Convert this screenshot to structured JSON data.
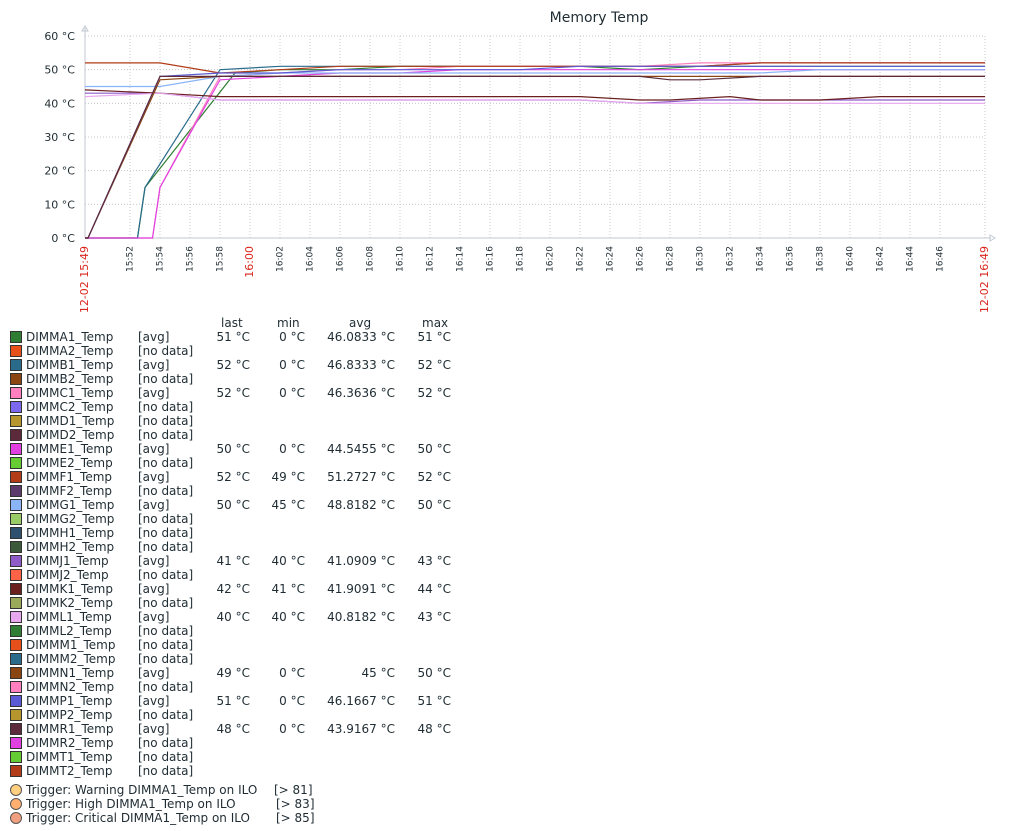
{
  "chart_data": {
    "type": "line",
    "title": "Memory Temp",
    "ylim": [
      0,
      60
    ],
    "y_ticks": [
      "0 °C",
      "10 °C",
      "20 °C",
      "30 °C",
      "40 °C",
      "50 °C",
      "60 °C"
    ],
    "x_start_label": "12-02 15:49",
    "x_end_label": "12-02 16:49",
    "x_mid_highlight_label": "16:00",
    "x_tick_labels": [
      "15:52",
      "15:54",
      "15:56",
      "15:58",
      "16:00",
      "16:02",
      "16:04",
      "16:06",
      "16:08",
      "16:10",
      "16:12",
      "16:14",
      "16:16",
      "16:18",
      "16:20",
      "16:22",
      "16:24",
      "16:26",
      "16:28",
      "16:30",
      "16:32",
      "16:34",
      "16:36",
      "16:38",
      "16:40",
      "16:42",
      "16:44",
      "16:46"
    ],
    "grid": true,
    "series": [
      {
        "name": "DIMMA1_Temp",
        "color": "#2e7d32",
        "x": [
          0,
          3.5,
          4,
          10,
          13,
          17,
          21,
          25,
          29,
          33,
          37,
          41,
          45,
          49,
          53,
          57,
          60
        ],
        "y": [
          0,
          0,
          15,
          49,
          50,
          50,
          51,
          51,
          51,
          51,
          50,
          51,
          51,
          51,
          51,
          51,
          51
        ]
      },
      {
        "name": "DIMMB1_Temp",
        "color": "#2a6b8c",
        "x": [
          0,
          3.5,
          4,
          9,
          13,
          17,
          21,
          25,
          29,
          33,
          37,
          41,
          45,
          49,
          53,
          57,
          60
        ],
        "y": [
          0,
          0,
          15,
          50,
          51,
          51,
          51,
          51,
          51,
          51,
          51,
          51,
          52,
          52,
          52,
          52,
          52
        ]
      },
      {
        "name": "DIMMC1_Temp",
        "color": "#ff7fbf",
        "x": [
          0,
          4.5,
          5,
          9,
          13,
          17,
          21,
          25,
          29,
          33,
          37,
          41,
          45,
          49,
          53,
          57,
          60
        ],
        "y": [
          0,
          0,
          15,
          48,
          49,
          50,
          50,
          51,
          51,
          51,
          51,
          52,
          52,
          52,
          52,
          52,
          52
        ]
      },
      {
        "name": "DIMME1_Temp",
        "color": "#e040e0",
        "x": [
          0,
          4.5,
          5,
          9,
          13,
          17,
          21,
          25,
          29,
          33,
          37,
          41,
          45,
          49,
          53,
          57,
          60
        ],
        "y": [
          0,
          0,
          15,
          47,
          48,
          49,
          49,
          50,
          50,
          50,
          50,
          50,
          50,
          50,
          50,
          50,
          50
        ]
      },
      {
        "name": "DIMMF1_Temp",
        "color": "#b23c17",
        "x": [
          0,
          5,
          9,
          13,
          17,
          21,
          25,
          29,
          33,
          37,
          41,
          45,
          49,
          53,
          57,
          60
        ],
        "y": [
          52,
          52,
          49,
          50,
          51,
          51,
          51,
          51,
          51,
          51,
          51,
          52,
          52,
          52,
          52,
          52
        ]
      },
      {
        "name": "DIMMG1_Temp",
        "color": "#8ab4f8",
        "x": [
          0,
          5,
          9,
          13,
          17,
          21,
          25,
          29,
          33,
          37,
          41,
          45,
          49,
          53,
          57,
          60
        ],
        "y": [
          45,
          45,
          48,
          49,
          49,
          49,
          49,
          49,
          49,
          49,
          49,
          49,
          50,
          50,
          50,
          50
        ]
      },
      {
        "name": "DIMMJ1_Temp",
        "color": "#8e5bc9",
        "x": [
          0,
          5,
          9,
          13,
          17,
          21,
          25,
          29,
          33,
          37,
          41,
          45,
          49,
          53,
          57,
          60
        ],
        "y": [
          43,
          43,
          41,
          41,
          41,
          41,
          41,
          41,
          41,
          40,
          41,
          41,
          41,
          41,
          41,
          41
        ]
      },
      {
        "name": "DIMMK1_Temp",
        "color": "#6b1f1f",
        "x": [
          0,
          5,
          9,
          13,
          17,
          21,
          25,
          29,
          33,
          37,
          39,
          43,
          45,
          49,
          53,
          57,
          60
        ],
        "y": [
          44,
          43,
          42,
          42,
          42,
          42,
          42,
          42,
          42,
          41,
          41,
          42,
          41,
          41,
          42,
          42,
          42
        ]
      },
      {
        "name": "DIMML1_Temp",
        "color": "#e8a8f0",
        "x": [
          0,
          5,
          9,
          13,
          17,
          21,
          25,
          29,
          33,
          37,
          41,
          45,
          49,
          53,
          57,
          60
        ],
        "y": [
          42,
          43,
          41,
          41,
          41,
          41,
          41,
          41,
          41,
          40,
          40,
          40,
          40,
          40,
          40,
          40
        ]
      },
      {
        "name": "DIMMN1_Temp",
        "color": "#8b4513",
        "x": [
          0,
          0.2,
          5,
          9,
          13,
          17,
          21,
          25,
          29,
          33,
          37,
          41,
          45,
          49,
          53,
          57,
          60
        ],
        "y": [
          0,
          0,
          47,
          48,
          48,
          48,
          48,
          48,
          48,
          48,
          48,
          48,
          48,
          48,
          48,
          48,
          48
        ]
      },
      {
        "name": "DIMMP1_Temp",
        "color": "#5a5ad6",
        "x": [
          0,
          0.2,
          5,
          9,
          13,
          17,
          21,
          25,
          29,
          33,
          37,
          41,
          45,
          49,
          53,
          57,
          60
        ],
        "y": [
          0,
          0,
          48,
          49,
          49,
          50,
          50,
          50,
          50,
          51,
          51,
          51,
          51,
          51,
          51,
          51,
          51
        ]
      },
      {
        "name": "DIMMR1_Temp",
        "color": "#5c2a3a",
        "x": [
          0,
          0.2,
          5,
          9,
          13,
          17,
          21,
          25,
          29,
          33,
          37,
          39,
          41,
          45,
          49,
          53,
          60
        ],
        "y": [
          0,
          0,
          48,
          48,
          48,
          48,
          48,
          48,
          48,
          48,
          48,
          47,
          47,
          48,
          48,
          48,
          48
        ]
      }
    ]
  },
  "legend": {
    "headers": {
      "last": "last",
      "min": "min",
      "avg": "avg",
      "max": "max"
    },
    "items": [
      {
        "name": "DIMMA1_Temp",
        "color": "#2e7d32",
        "func": "[avg]",
        "last": "51 °C",
        "min": "0 °C",
        "avg": "46.0833 °C",
        "max": "51 °C"
      },
      {
        "name": "DIMMA2_Temp",
        "color": "#e8501b",
        "func": "[no data]",
        "last": "",
        "min": "",
        "avg": "",
        "max": ""
      },
      {
        "name": "DIMMB1_Temp",
        "color": "#2a6b8c",
        "func": "[avg]",
        "last": "52 °C",
        "min": "0 °C",
        "avg": "46.8333 °C",
        "max": "52 °C"
      },
      {
        "name": "DIMMB2_Temp",
        "color": "#8b4513",
        "func": "[no data]",
        "last": "",
        "min": "",
        "avg": "",
        "max": ""
      },
      {
        "name": "DIMMC1_Temp",
        "color": "#ff7fbf",
        "func": "[avg]",
        "last": "52 °C",
        "min": "0 °C",
        "avg": "46.3636 °C",
        "max": "52 °C"
      },
      {
        "name": "DIMMC2_Temp",
        "color": "#7b68ee",
        "func": "[no data]",
        "last": "",
        "min": "",
        "avg": "",
        "max": ""
      },
      {
        "name": "DIMMD1_Temp",
        "color": "#b8962e",
        "func": "[no data]",
        "last": "",
        "min": "",
        "avg": "",
        "max": ""
      },
      {
        "name": "DIMMD2_Temp",
        "color": "#5c2a3a",
        "func": "[no data]",
        "last": "",
        "min": "",
        "avg": "",
        "max": ""
      },
      {
        "name": "DIMME1_Temp",
        "color": "#e040e0",
        "func": "[avg]",
        "last": "50 °C",
        "min": "0 °C",
        "avg": "44.5455 °C",
        "max": "50 °C"
      },
      {
        "name": "DIMME2_Temp",
        "color": "#66cc33",
        "func": "[no data]",
        "last": "",
        "min": "",
        "avg": "",
        "max": ""
      },
      {
        "name": "DIMMF1_Temp",
        "color": "#b23c17",
        "func": "[avg]",
        "last": "52 °C",
        "min": "49 °C",
        "avg": "51.2727 °C",
        "max": "52 °C"
      },
      {
        "name": "DIMMF2_Temp",
        "color": "#5c3a6b",
        "func": "[no data]",
        "last": "",
        "min": "",
        "avg": "",
        "max": ""
      },
      {
        "name": "DIMMG1_Temp",
        "color": "#8ab4f8",
        "func": "[avg]",
        "last": "50 °C",
        "min": "45 °C",
        "avg": "48.8182 °C",
        "max": "50 °C"
      },
      {
        "name": "DIMMG2_Temp",
        "color": "#99cc66",
        "func": "[no data]",
        "last": "",
        "min": "",
        "avg": "",
        "max": ""
      },
      {
        "name": "DIMMH1_Temp",
        "color": "#2f4f6f",
        "func": "[no data]",
        "last": "",
        "min": "",
        "avg": "",
        "max": ""
      },
      {
        "name": "DIMMH2_Temp",
        "color": "#3a5a3a",
        "func": "[no data]",
        "last": "",
        "min": "",
        "avg": "",
        "max": ""
      },
      {
        "name": "DIMMJ1_Temp",
        "color": "#8e5bc9",
        "func": "[avg]",
        "last": "41 °C",
        "min": "40 °C",
        "avg": "41.0909 °C",
        "max": "43 °C"
      },
      {
        "name": "DIMMJ2_Temp",
        "color": "#ff6347",
        "func": "[no data]",
        "last": "",
        "min": "",
        "avg": "",
        "max": ""
      },
      {
        "name": "DIMMK1_Temp",
        "color": "#6b1f1f",
        "func": "[avg]",
        "last": "42 °C",
        "min": "41 °C",
        "avg": "41.9091 °C",
        "max": "44 °C"
      },
      {
        "name": "DIMMK2_Temp",
        "color": "#9aaa5a",
        "func": "[no data]",
        "last": "",
        "min": "",
        "avg": "",
        "max": ""
      },
      {
        "name": "DIMML1_Temp",
        "color": "#e8a8f0",
        "func": "[avg]",
        "last": "40 °C",
        "min": "40 °C",
        "avg": "40.8182 °C",
        "max": "43 °C"
      },
      {
        "name": "DIMML2_Temp",
        "color": "#2e7d32",
        "func": "[no data]",
        "last": "",
        "min": "",
        "avg": "",
        "max": ""
      },
      {
        "name": "DIMMM1_Temp",
        "color": "#e8501b",
        "func": "[no data]",
        "last": "",
        "min": "",
        "avg": "",
        "max": ""
      },
      {
        "name": "DIMMM2_Temp",
        "color": "#2a6b8c",
        "func": "[no data]",
        "last": "",
        "min": "",
        "avg": "",
        "max": ""
      },
      {
        "name": "DIMMN1_Temp",
        "color": "#8b4513",
        "func": "[avg]",
        "last": "49 °C",
        "min": "0 °C",
        "avg": "45 °C",
        "max": "50 °C"
      },
      {
        "name": "DIMMN2_Temp",
        "color": "#ff7fbf",
        "func": "[no data]",
        "last": "",
        "min": "",
        "avg": "",
        "max": ""
      },
      {
        "name": "DIMMP1_Temp",
        "color": "#5a5ad6",
        "func": "[avg]",
        "last": "51 °C",
        "min": "0 °C",
        "avg": "46.1667 °C",
        "max": "51 °C"
      },
      {
        "name": "DIMMP2_Temp",
        "color": "#b8962e",
        "func": "[no data]",
        "last": "",
        "min": "",
        "avg": "",
        "max": ""
      },
      {
        "name": "DIMMR1_Temp",
        "color": "#5c2a3a",
        "func": "[avg]",
        "last": "48 °C",
        "min": "0 °C",
        "avg": "43.9167 °C",
        "max": "48 °C"
      },
      {
        "name": "DIMMR2_Temp",
        "color": "#e040e0",
        "func": "[no data]",
        "last": "",
        "min": "",
        "avg": "",
        "max": ""
      },
      {
        "name": "DIMMT1_Temp",
        "color": "#66cc33",
        "func": "[no data]",
        "last": "",
        "min": "",
        "avg": "",
        "max": ""
      },
      {
        "name": "DIMMT2_Temp",
        "color": "#b23c17",
        "func": "[no data]",
        "last": "",
        "min": "",
        "avg": "",
        "max": ""
      }
    ]
  },
  "triggers": [
    {
      "label": "Trigger: Warning DIMMA1_Temp on ILO",
      "threshold": "[> 81]",
      "color": "#ffd080"
    },
    {
      "label": "Trigger: High DIMMA1_Temp on ILO",
      "threshold": "[> 83]",
      "color": "#ffb070"
    },
    {
      "label": "Trigger: Critical DIMMA1_Temp on ILO",
      "threshold": "[> 85]",
      "color": "#f0a080"
    }
  ],
  "colors": {
    "grid": "#c8c8c8",
    "axis": "#c0c8d0",
    "highlight_label": "#d9261c",
    "text": "#1f2c33"
  }
}
